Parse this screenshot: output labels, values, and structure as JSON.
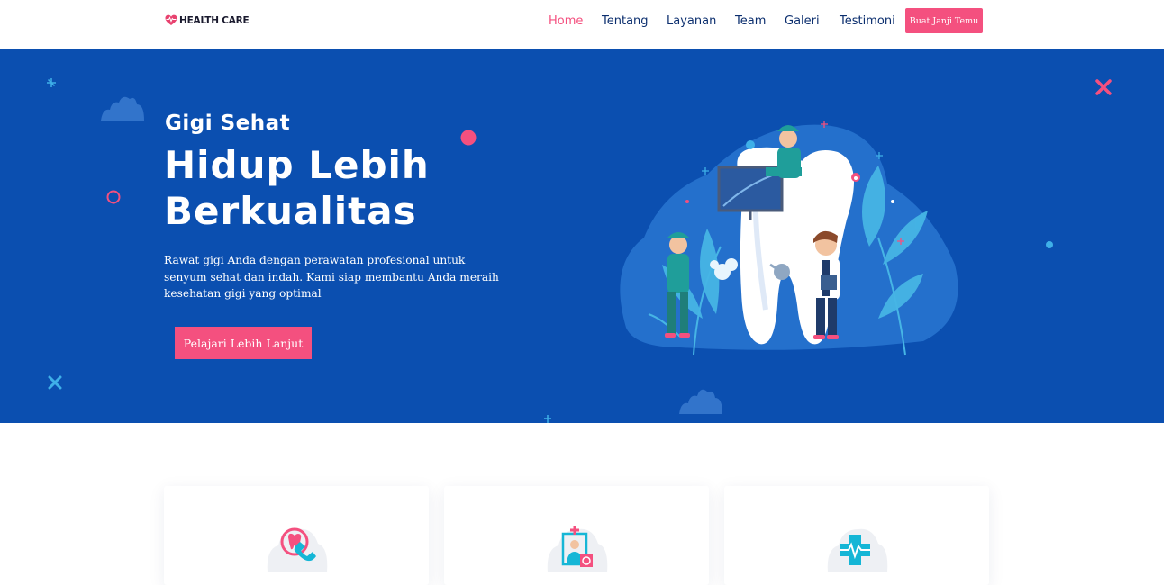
{
  "brand": {
    "name": "HEALTH CARE",
    "accent": "#f4507f",
    "primary": "#0b4fb0",
    "navy": "#0b2e6e"
  },
  "nav": {
    "items": [
      {
        "label": "Home",
        "active": true
      },
      {
        "label": "Tentang",
        "active": false
      },
      {
        "label": "Layanan",
        "active": false
      },
      {
        "label": "Team",
        "active": false
      },
      {
        "label": "Galeri",
        "active": false
      },
      {
        "label": "Testimoni",
        "active": false
      }
    ],
    "cta_label": "Buat Janji Temu"
  },
  "hero": {
    "subtitle": "Gigi Sehat",
    "title": "Hidup Lebih Berkualitas",
    "description": "Rawat gigi Anda dengan perawatan profesional untuk senyum sehat dan indah. Kami siap membantu Anda meraih kesehatan gigi yang optimal",
    "button_label": "Pelajari Lebih Lanjut",
    "illustration": "dentist-team-with-giant-tooth-illustration"
  },
  "cards": [
    {
      "icon": "tooth-phone-icon"
    },
    {
      "icon": "doctor-schedule-icon"
    },
    {
      "icon": "medical-cross-pulse-icon"
    }
  ]
}
